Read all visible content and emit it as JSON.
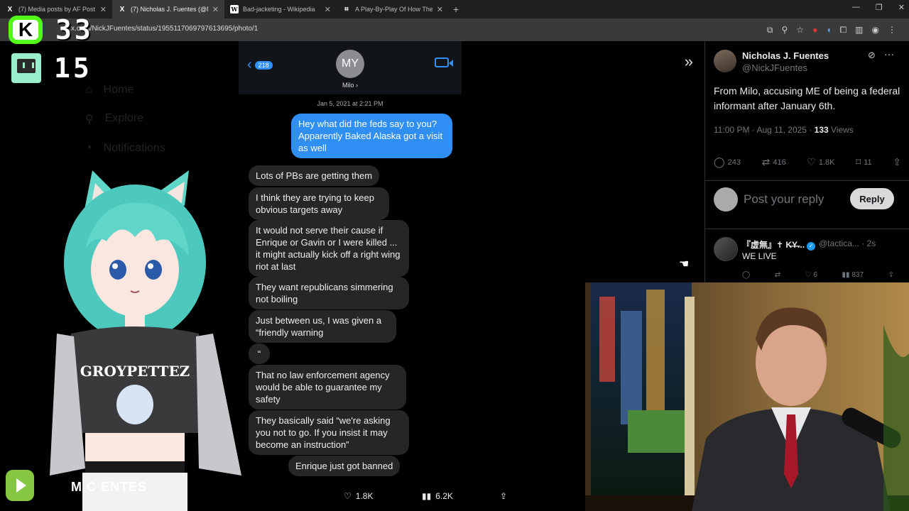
{
  "browser": {
    "tabs": [
      {
        "favicon": "X",
        "title": "(7) Media posts by AF Post (@A",
        "active": false
      },
      {
        "favicon": "X",
        "title": "(7) Nicholas J. Fuentes (@NickJ",
        "active": true
      },
      {
        "favicon": "W",
        "title": "Bad-jacketing - Wikipedia",
        "active": false
      },
      {
        "favicon": "",
        "title": "A Play-By-Play Of How The Tru",
        "active": false
      }
    ],
    "new_tab": "+",
    "url": "x.com/NickJFuentes/status/1955117069797613695/photo/1"
  },
  "overlay": {
    "kick_letter": "K",
    "kick_count": "33",
    "twitch_count": "15",
    "streamer_name": "NICK J FUENTES",
    "streamer_name_visible": "M                 C  ENTES"
  },
  "dim_nav": [
    "Home",
    "Explore",
    "Notifications"
  ],
  "photo": {
    "back_count": "218",
    "contact_initials": "MY",
    "contact_name": "Milo ›",
    "date": "Jan 5, 2021 at 2:21 PM",
    "outgoing": "Hey what did the feds say to you? Apparently Baked Alaska got a visit as well",
    "incoming": [
      "Lots of PBs are getting them",
      "I think they are trying to keep obvious targets away",
      "It would not serve their cause if Enrique or Gavin or I were killed ... it might actually kick off a right wing riot at last",
      "They want republicans simmering not boiling",
      "Just between us, I was given a “friendly warning",
      "“",
      "That no law enforcement agency would be able to guarantee my safety",
      "They basically said “we're asking you not to go. If you insist it may become an instruction”",
      "Enrique just got banned"
    ]
  },
  "photo_stats": {
    "likes": "1.8K",
    "views": "6.2K"
  },
  "tweet": {
    "name": "Nicholas J. Fuentes",
    "handle": "@NickJFuentes",
    "text": "From Milo, accusing ME of being a federal informant after January 6th.",
    "time": "11:00 PM · Aug 11, 2025 · ",
    "views_count": "133",
    "views_label": " Views",
    "replies": "243",
    "reposts": "416",
    "likes": "1.8K",
    "bookmarks": "11",
    "reply_placeholder": "Post your reply",
    "reply_button": "Reply"
  },
  "comment": {
    "name": "『虚無』✝ K̶Y̶...",
    "handle": "@tactica... · 2s",
    "text": "WE LIVE",
    "likes": "6",
    "views": "837"
  },
  "colors": {
    "imessage_blue": "#2f8ff5",
    "kick_green": "#53fc18",
    "rumble_green": "#85c742",
    "x_link": "#1d9bf0"
  }
}
